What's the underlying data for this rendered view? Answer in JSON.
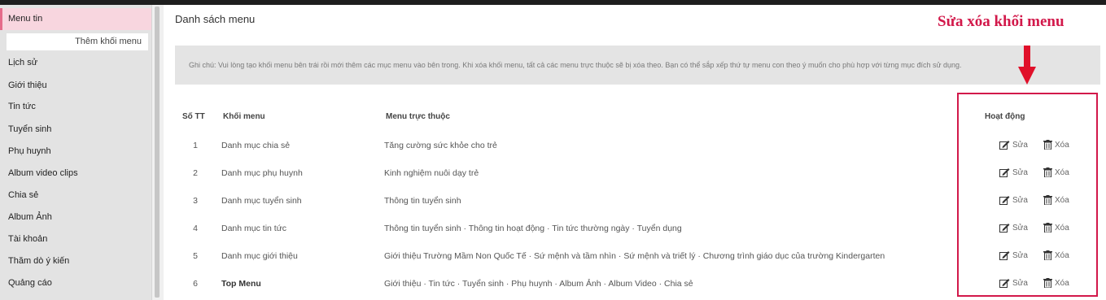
{
  "sidebar": {
    "items": [
      {
        "label": "Menu tin",
        "active": true
      },
      {
        "label": "Lịch sử"
      },
      {
        "label": "Giới thiệu"
      },
      {
        "label": "Tin tức"
      },
      {
        "label": "Tuyển sinh"
      },
      {
        "label": "Phụ huynh"
      },
      {
        "label": "Album video clips"
      },
      {
        "label": "Chia sẻ"
      },
      {
        "label": "Album Ảnh"
      },
      {
        "label": "Tài khoản"
      },
      {
        "label": "Thăm dò ý kiến"
      },
      {
        "label": "Quảng cáo"
      }
    ],
    "sub_item": "Thêm khối menu"
  },
  "main": {
    "title": "Danh sách menu",
    "notice": "Ghi chú: Vui lòng tạo khối menu bên trái rồi mới thêm các mục menu vào bên trong. Khi xóa khối menu, tất cả các menu trực thuộc sẽ bị xóa theo. Bạn có thể sắp xếp thứ tự menu con theo ý muốn cho phù hợp với từng mục đích sử dụng.",
    "annotation": "Sửa xóa khối menu",
    "table": {
      "headers": {
        "stt": "Số TT",
        "block": "Khối menu",
        "children": "Menu trực thuộc",
        "actions": "Hoạt động"
      },
      "edit_label": "Sửa",
      "delete_label": "Xóa",
      "rows": [
        {
          "stt": "1",
          "block": "Danh mục chia sẻ",
          "children": "Tăng cường sức khỏe cho trẻ",
          "bold": false
        },
        {
          "stt": "2",
          "block": "Danh mục phụ huynh",
          "children": "Kinh nghiệm nuôi dạy trẻ",
          "bold": false
        },
        {
          "stt": "3",
          "block": "Danh mục tuyển sinh",
          "children": "Thông tin tuyển sinh",
          "bold": false
        },
        {
          "stt": "4",
          "block": "Danh mục tin tức",
          "children": "Thông tin tuyển sinh · Thông tin hoạt động · Tin tức thường ngày · Tuyển dụng",
          "bold": false
        },
        {
          "stt": "5",
          "block": "Danh mục giới thiệu",
          "children": "Giới thiệu Trường Mầm Non Quốc Tế · Sứ mệnh và tầm nhìn · Sứ mệnh và triết lý · Chương trình giáo dục của trường Kindergarten",
          "bold": false
        },
        {
          "stt": "6",
          "block": "Top Menu",
          "children": "Giới thiệu · Tin tức · Tuyển sinh · Phụ huynh · Album Ảnh · Album Video · Chia sẻ",
          "bold": true
        }
      ]
    }
  },
  "colors": {
    "accent": "#d2184a",
    "active_bg": "#f8d6df",
    "notice_bg": "#e4e4e4"
  }
}
